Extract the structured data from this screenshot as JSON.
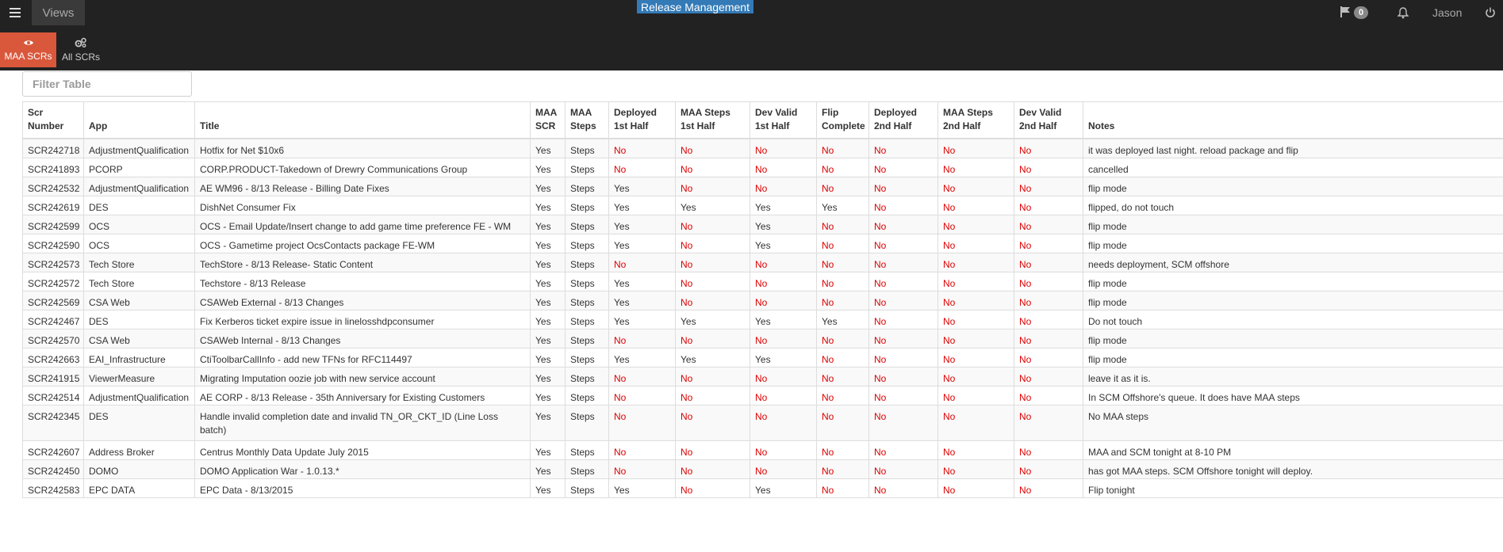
{
  "topbar": {
    "views_label": "Views",
    "brand": "Release Management",
    "flag_count": "0",
    "user": "Jason"
  },
  "tabs": [
    {
      "label": "MAA SCRs",
      "icon": "eye-icon"
    },
    {
      "label": "All SCRs",
      "icon": "gears-icon"
    }
  ],
  "filter": {
    "placeholder": "Filter Table"
  },
  "colors": {
    "topbar": "#222222",
    "active_tab": "#d9583c",
    "brand": "#337ab7",
    "no": "#dd0000"
  },
  "table": {
    "headers": [
      "Scr Number",
      "App",
      "Title",
      "MAA SCR",
      "MAA Steps",
      "Deployed 1st Half",
      "MAA Steps 1st Half",
      "Dev Valid 1st Half",
      "Flip Complete",
      "Deployed 2nd Half",
      "MAA Steps 2nd Half",
      "Dev Valid 2nd Half",
      "Notes"
    ],
    "rows": [
      [
        "SCR242718",
        "AdjustmentQualification",
        "Hotfix for Net $10x6",
        "Yes",
        "Steps",
        "No",
        "No",
        "No",
        "No",
        "No",
        "No",
        "No",
        "it was deployed last night. reload package and flip"
      ],
      [
        "SCR241893",
        "PCORP",
        "CORP.PRODUCT-Takedown of Drewry Communications Group",
        "Yes",
        "Steps",
        "No",
        "No",
        "No",
        "No",
        "No",
        "No",
        "No",
        "cancelled"
      ],
      [
        "SCR242532",
        "AdjustmentQualification",
        "AE WM96 - 8/13 Release - Billing Date Fixes",
        "Yes",
        "Steps",
        "Yes",
        "No",
        "No",
        "No",
        "No",
        "No",
        "No",
        "flip mode"
      ],
      [
        "SCR242619",
        "DES",
        "DishNet Consumer Fix",
        "Yes",
        "Steps",
        "Yes",
        "Yes",
        "Yes",
        "Yes",
        "No",
        "No",
        "No",
        "flipped, do not touch"
      ],
      [
        "SCR242599",
        "OCS",
        "OCS - Email Update/Insert change to add game time preference FE - WM",
        "Yes",
        "Steps",
        "Yes",
        "No",
        "Yes",
        "No",
        "No",
        "No",
        "No",
        "flip mode"
      ],
      [
        "SCR242590",
        "OCS",
        "OCS - Gametime project OcsContacts package FE-WM",
        "Yes",
        "Steps",
        "Yes",
        "No",
        "Yes",
        "No",
        "No",
        "No",
        "No",
        "flip mode"
      ],
      [
        "SCR242573",
        "Tech Store",
        "TechStore - 8/13 Release- Static Content",
        "Yes",
        "Steps",
        "No",
        "No",
        "No",
        "No",
        "No",
        "No",
        "No",
        "needs deployment, SCM offshore"
      ],
      [
        "SCR242572",
        "Tech Store",
        "Techstore - 8/13 Release",
        "Yes",
        "Steps",
        "Yes",
        "No",
        "No",
        "No",
        "No",
        "No",
        "No",
        "flip mode"
      ],
      [
        "SCR242569",
        "CSA Web",
        "CSAWeb External - 8/13 Changes",
        "Yes",
        "Steps",
        "Yes",
        "No",
        "No",
        "No",
        "No",
        "No",
        "No",
        "flip mode"
      ],
      [
        "SCR242467",
        "DES",
        "Fix Kerberos ticket expire issue in linelosshdpconsumer",
        "Yes",
        "Steps",
        "Yes",
        "Yes",
        "Yes",
        "Yes",
        "No",
        "No",
        "No",
        "Do not touch"
      ],
      [
        "SCR242570",
        "CSA Web",
        "CSAWeb Internal - 8/13 Changes",
        "Yes",
        "Steps",
        "No",
        "No",
        "No",
        "No",
        "No",
        "No",
        "No",
        "flip mode"
      ],
      [
        "SCR242663",
        "EAI_Infrastructure",
        "CtiToolbarCallInfo - add new TFNs for RFC114497",
        "Yes",
        "Steps",
        "Yes",
        "Yes",
        "Yes",
        "No",
        "No",
        "No",
        "No",
        "flip mode"
      ],
      [
        "SCR241915",
        "ViewerMeasure",
        "Migrating Imputation oozie job with new service account",
        "Yes",
        "Steps",
        "No",
        "No",
        "No",
        "No",
        "No",
        "No",
        "No",
        "leave it as it is."
      ],
      [
        "SCR242514",
        "AdjustmentQualification",
        "AE CORP - 8/13 Release - 35th Anniversary for Existing Customers",
        "Yes",
        "Steps",
        "No",
        "No",
        "No",
        "No",
        "No",
        "No",
        "No",
        "In SCM Offshore's queue. It does have MAA steps"
      ],
      [
        "SCR242345",
        "DES",
        "Handle invalid completion date and invalid TN_OR_CKT_ID (Line Loss batch)",
        "Yes",
        "Steps",
        "No",
        "No",
        "No",
        "No",
        "No",
        "No",
        "No",
        "No MAA steps"
      ],
      [
        "SCR242607",
        "Address Broker",
        "Centrus Monthly Data Update July 2015",
        "Yes",
        "Steps",
        "No",
        "No",
        "No",
        "No",
        "No",
        "No",
        "No",
        "MAA and SCM tonight at 8-10 PM"
      ],
      [
        "SCR242450",
        "DOMO",
        "DOMO Application War - 1.0.13.*",
        "Yes",
        "Steps",
        "No",
        "No",
        "No",
        "No",
        "No",
        "No",
        "No",
        "has got MAA steps. SCM Offshore tonight will deploy."
      ],
      [
        "SCR242583",
        "EPC DATA",
        "EPC Data - 8/13/2015",
        "Yes",
        "Steps",
        "Yes",
        "No",
        "Yes",
        "No",
        "No",
        "No",
        "No",
        "Flip tonight"
      ]
    ]
  }
}
